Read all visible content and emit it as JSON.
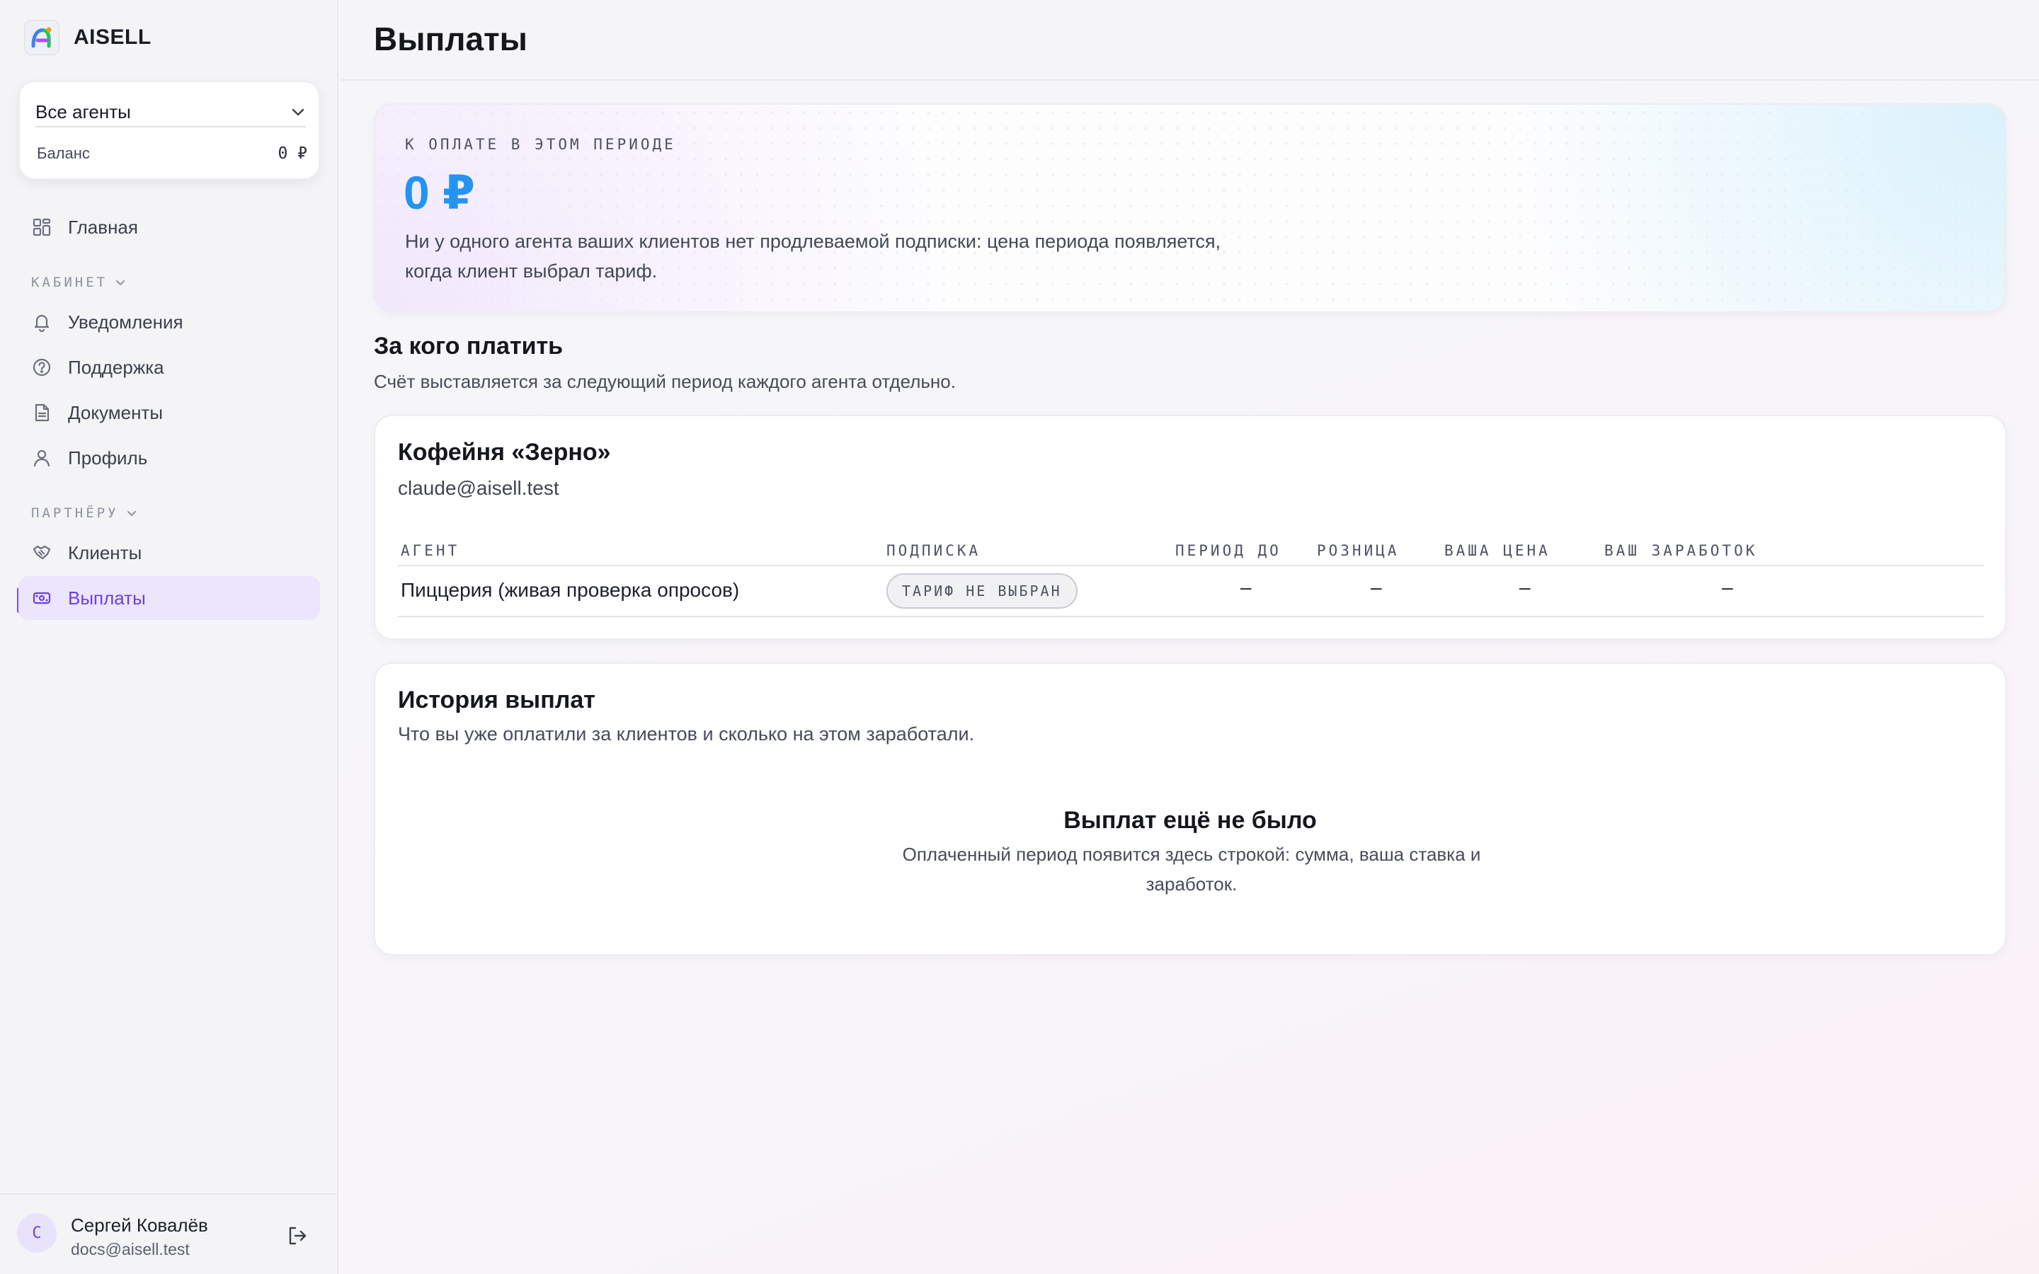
{
  "app": {
    "name": "AISELL"
  },
  "agent_selector": {
    "value": "Все агенты",
    "balance_label": "Баланс",
    "balance_value": "0 ₽"
  },
  "nav": {
    "home": "Главная",
    "section_cabinet": "КАБИНЕТ",
    "notifications": "Уведомления",
    "support": "Поддержка",
    "documents": "Документы",
    "profile": "Профиль",
    "section_partner": "ПАРТНЁРУ",
    "clients": "Клиенты",
    "payouts": "Выплаты"
  },
  "user": {
    "initial": "С",
    "name": "Сергей Ковалёв",
    "email": "docs@aisell.test"
  },
  "page": {
    "title": "Выплаты"
  },
  "due": {
    "label": "К ОПЛАТЕ В ЭТОМ ПЕРИОДЕ",
    "amount": "0 ₽",
    "description": "Ни у одного агента ваших клиентов нет продлеваемой подписки: цена периода появляется, когда клиент выбрал тариф."
  },
  "who_to_pay": {
    "title": "За кого платить",
    "subtitle": "Счёт выставляется за следующий период каждого агента отдельно."
  },
  "client": {
    "name": "Кофейня «Зерно»",
    "email": "claude@aisell.test",
    "columns": [
      "АГЕНТ",
      "ПОДПИСКА",
      "ПЕРИОД ДО",
      "РОЗНИЦА",
      "ВАША ЦЕНА",
      "ВАШ ЗАРАБОТОК"
    ],
    "rows": [
      {
        "agent": "Пиццерия (живая проверка опросов)",
        "subscription": "ТАРИФ НЕ ВЫБРАН",
        "period_until": "–",
        "retail": "–",
        "your_price": "–",
        "your_earnings": "–"
      }
    ]
  },
  "history": {
    "title": "История выплат",
    "subtitle": "Что вы уже оплатили за клиентов и сколько на этом заработали.",
    "empty_title": "Выплат ещё не было",
    "empty_desc": "Оплаченный период появится здесь строкой: сумма, ваша ставка и заработок."
  },
  "colors": {
    "accent": "#7c4dff",
    "amount": "#2494f0",
    "active_bg": "#ebe6fb"
  }
}
